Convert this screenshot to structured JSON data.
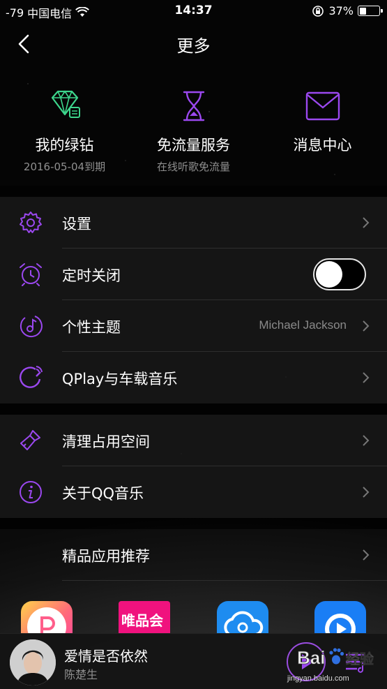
{
  "status_bar": {
    "signal": "-79",
    "carrier": "中国电信",
    "time": "14:37",
    "battery_percent": "37%",
    "battery_level": 0.37
  },
  "nav": {
    "title": "更多",
    "back_icon": "chevron-left-icon"
  },
  "shortcuts": [
    {
      "icon": "diamond-icon",
      "title": "我的绿钻",
      "subtitle": "2016-05-04到期",
      "color": "#3dd68c"
    },
    {
      "icon": "hourglass-icon",
      "title": "免流量服务",
      "subtitle": "在线听歌免流量",
      "color": "#9b48ef"
    },
    {
      "icon": "envelope-icon",
      "title": "消息中心",
      "subtitle": "",
      "color": "#9b48ef"
    }
  ],
  "group1": [
    {
      "icon": "gear-icon",
      "label": "设置"
    },
    {
      "icon": "alarm-clock-icon",
      "label": "定时关闭",
      "toggle_on": false
    },
    {
      "icon": "theme-icon",
      "label": "个性主题",
      "value": "Michael Jackson"
    },
    {
      "icon": "qplay-icon",
      "label": "QPlay与车载音乐"
    }
  ],
  "group2": [
    {
      "icon": "brush-icon",
      "label": "清理占用空间"
    },
    {
      "icon": "info-icon",
      "label": "关于QQ音乐"
    }
  ],
  "group3": [
    {
      "label": "精品应用推荐"
    }
  ],
  "apps": [
    {
      "icon": "p-app-icon"
    },
    {
      "icon": "vip-app-icon",
      "text": "唯品会"
    },
    {
      "icon": "cloud-app-icon"
    },
    {
      "icon": "video-app-icon"
    }
  ],
  "player": {
    "song": "爱情是否依然",
    "artist": "陈楚生"
  },
  "watermark": {
    "brand": "Bai",
    "suffix": "经验",
    "url": "jingyan.baidu.com"
  },
  "accent_color": "#9b48ef"
}
